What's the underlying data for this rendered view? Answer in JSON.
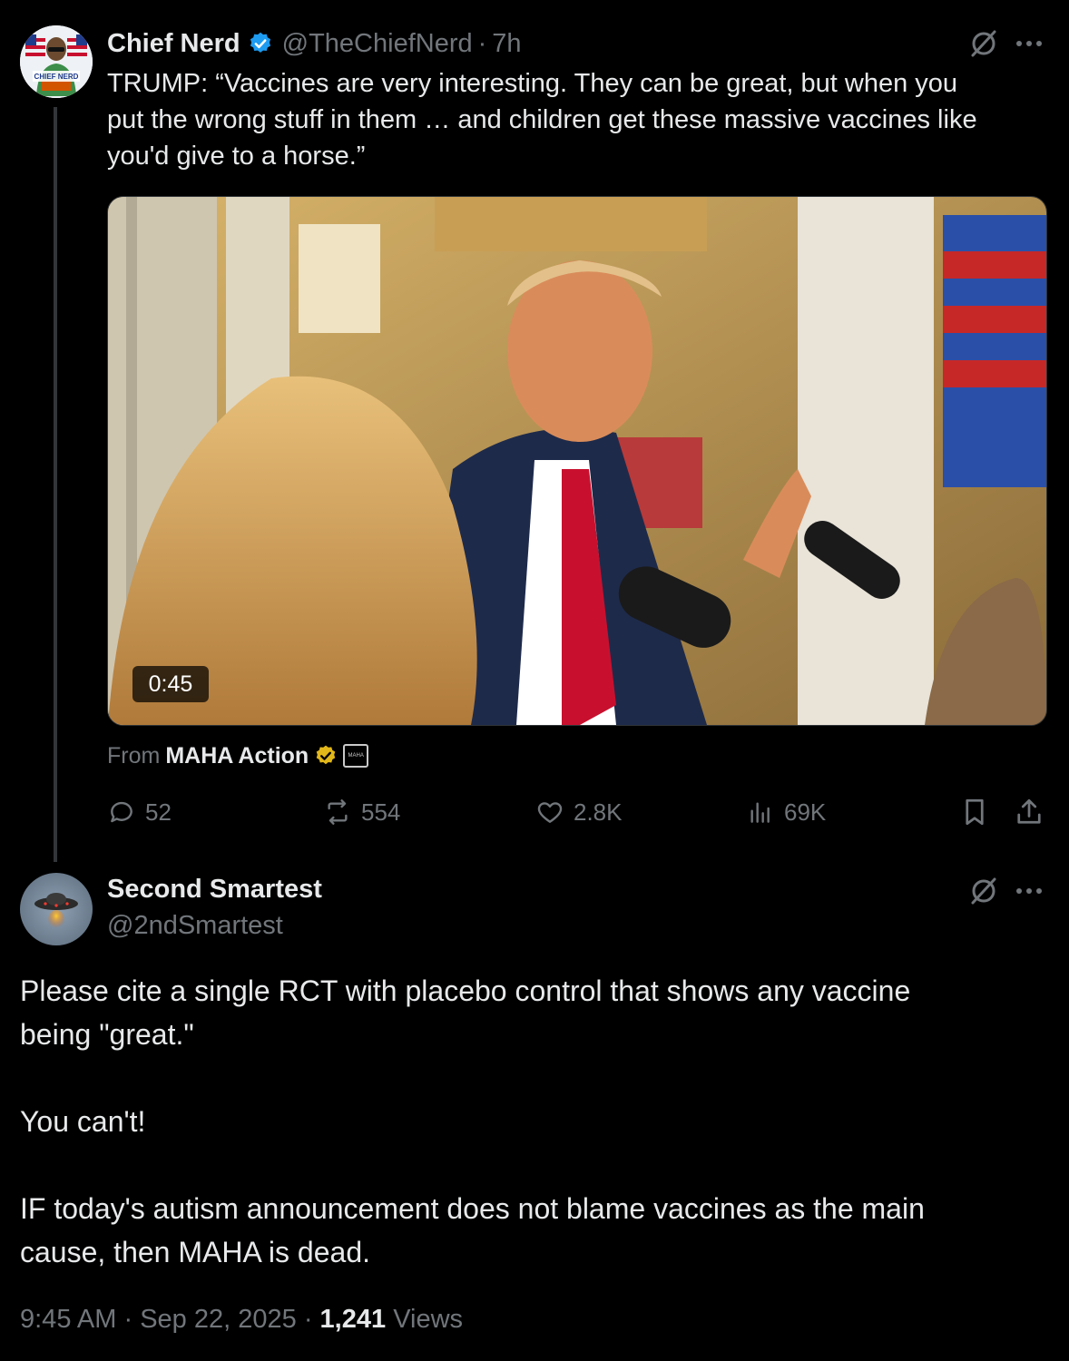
{
  "original_tweet": {
    "author_name": "Chief Nerd",
    "handle": "@TheChiefNerd",
    "separator": "·",
    "time_ago": "7h",
    "text_lines": [
      "TRUMP: “Vaccines are very interesting. They can be great, but when you",
      "put the wrong stuff in them … and children get these massive vaccines like",
      "you'd give to a horse.”"
    ],
    "avatar_icon": "chief-nerd-avatar",
    "avatar_text": "CHIEF NERD",
    "verified_color": "#1d9bf0",
    "video_duration": "0:45",
    "source_prefix": "From",
    "source_name": "MAHA Action",
    "source_badge_color": "#e2b719",
    "source_icon_text": "MAHA",
    "stats": {
      "replies": "52",
      "reposts": "554",
      "likes": "2.8K",
      "views": "69K"
    }
  },
  "reply_tweet": {
    "author_name": "Second Smartest",
    "handle": "@2ndSmartest",
    "avatar_icon": "ufo-avatar",
    "paragraphs": [
      "Please cite a single RCT with placebo control that shows any vaccine",
      "being \"great.\"",
      "You can't!",
      "IF today's autism announcement does not blame vaccines as the main",
      "cause, then MAHA is dead."
    ],
    "footer": {
      "time": "9:45 AM",
      "separator": "·",
      "date": "Sep 22, 2025",
      "views_count": "1,241",
      "views_label": "Views"
    }
  },
  "colors": {
    "background": "#000000",
    "text": "#e7e9ea",
    "muted": "#71767b"
  }
}
